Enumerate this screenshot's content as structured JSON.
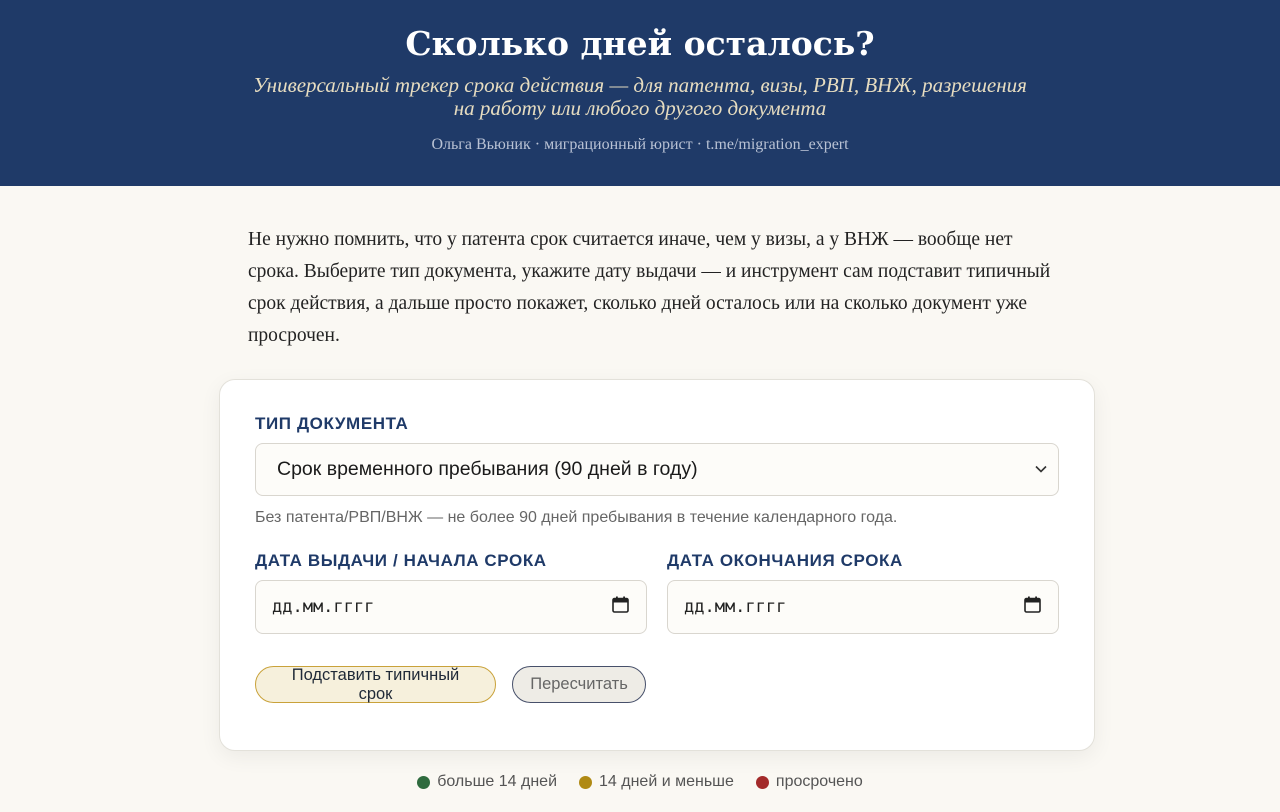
{
  "header": {
    "title": "Сколько дней осталось?",
    "subtitle": "Универсальный трекер срока действия — для патента, визы, РВП, ВНЖ, разрешения на работу или любого другого документа",
    "author": "Ольга Вьюник · миграционный юрист · t.me/migration_expert"
  },
  "intro": "Не нужно помнить, что у патента срок считается иначе, чем у визы, а у ВНЖ — вообще нет срока. Выберите тип документа, укажите дату выдачи — и инструмент сам подставит типичный срок действия, а дальше просто покажет, сколько дней осталось или на сколько документ уже просрочен.",
  "form": {
    "doc_type_label": "Тип документа",
    "doc_type_value": "Срок временного пребывания (90 дней в году)",
    "doc_type_hint": "Без патента/РВП/ВНЖ — не более 90 дней пребывания в течение календарного года.",
    "start_label": "Дата выдачи / начала срока",
    "start_placeholder": "дд.мм.гггг",
    "end_label": "Дата окончания срока",
    "end_placeholder": "дд.мм.гггг",
    "fill_button": "Подставить типичный срок",
    "recalc_button": "Пересчитать"
  },
  "legend": [
    {
      "label": "больше 14 дней",
      "color": "#2f6b3e"
    },
    {
      "label": "14 дней и меньше",
      "color": "#b08a14"
    },
    {
      "label": "просрочено",
      "color": "#a32a2a"
    }
  ],
  "icons": {
    "select": "chevron-down-icon",
    "date": "calendar-icon"
  }
}
